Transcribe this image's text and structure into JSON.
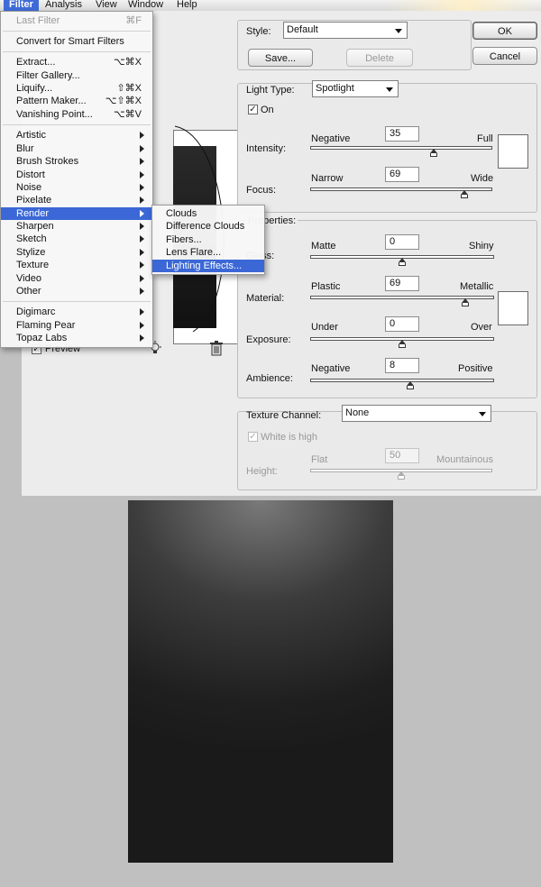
{
  "menubar": {
    "items": [
      "Filter",
      "Analysis",
      "View",
      "Window",
      "Help"
    ]
  },
  "filter_menu": {
    "last_filter": {
      "label": "Last Filter",
      "shortcut": "⌘F"
    },
    "convert": "Convert for Smart Filters",
    "group1": [
      {
        "label": "Extract...",
        "shortcut": "⌥⌘X"
      },
      {
        "label": "Filter Gallery...",
        "shortcut": ""
      },
      {
        "label": "Liquify...",
        "shortcut": "⇧⌘X"
      },
      {
        "label": "Pattern Maker...",
        "shortcut": "⌥⇧⌘X"
      },
      {
        "label": "Vanishing Point...",
        "shortcut": "⌥⌘V"
      }
    ],
    "group2": [
      "Artistic",
      "Blur",
      "Brush Strokes",
      "Distort",
      "Noise",
      "Pixelate",
      "Render",
      "Sharpen",
      "Sketch",
      "Stylize",
      "Texture",
      "Video",
      "Other"
    ],
    "group3": [
      "Digimarc",
      "Flaming Pear",
      "Topaz Labs"
    ]
  },
  "render_submenu": [
    "Clouds",
    "Difference Clouds",
    "Fibers...",
    "Lens Flare...",
    "Lighting Effects..."
  ],
  "dialog": {
    "style_label": "Style:",
    "style_value": "Default",
    "save_label": "Save...",
    "delete_label": "Delete",
    "ok_label": "OK",
    "cancel_label": "Cancel",
    "light_type_label": "Light Type:",
    "light_type_value": "Spotlight",
    "on_label": "On",
    "intensity": {
      "label": "Intensity:",
      "min": "Negative",
      "max": "Full",
      "value": "35"
    },
    "focus": {
      "label": "Focus:",
      "min": "Narrow",
      "max": "Wide",
      "value": "69"
    },
    "properties_label": "Properties:",
    "gloss": {
      "label": "Gloss:",
      "min": "Matte",
      "max": "Shiny",
      "value": "0"
    },
    "material": {
      "label": "Material:",
      "min": "Plastic",
      "max": "Metallic",
      "value": "69"
    },
    "exposure": {
      "label": "Exposure:",
      "min": "Under",
      "max": "Over",
      "value": "0"
    },
    "ambience": {
      "label": "Ambience:",
      "min": "Negative",
      "max": "Positive",
      "value": "8"
    },
    "texture_channel_label": "Texture Channel:",
    "texture_channel_value": "None",
    "white_is_high_label": "White is high",
    "height": {
      "label": "Height:",
      "min": "Flat",
      "max": "Mountainous",
      "value": "50"
    },
    "preview_label": "Preview"
  },
  "colors": {
    "menu_highlight": "#3b68d6",
    "dialog_bg": "#ececec"
  }
}
